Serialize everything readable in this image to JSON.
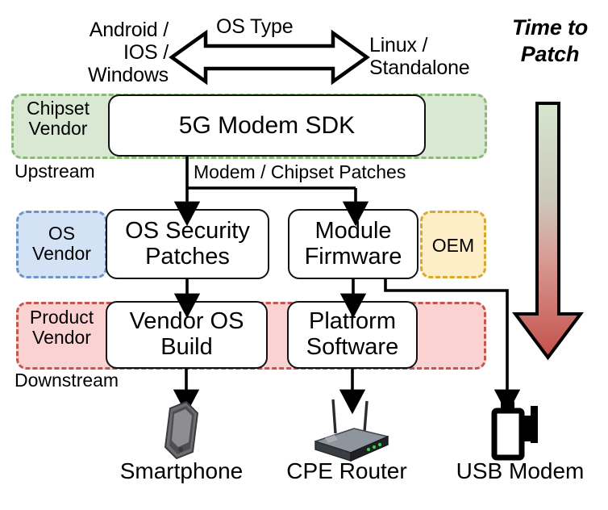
{
  "diagram": {
    "title_arrow": "Time to\nPatch",
    "os_type": {
      "label": "OS Type",
      "left_text": "Android /\nIOS /\nWindows",
      "right_text": "Linux /\nStandalone",
      "icon": "double-headed-arrow-icon"
    },
    "regions": [
      {
        "id": "chipset-vendor",
        "tag": "Chipset\nVendor",
        "fill": "#d9e8d2",
        "stroke": "#8cb87a"
      },
      {
        "id": "os-vendor",
        "tag": "OS\nVendor",
        "fill": "#d3e2f5",
        "stroke": "#6f93c4"
      },
      {
        "id": "oem",
        "tag": "OEM",
        "fill": "#fdeec7",
        "stroke": "#d8a92c"
      },
      {
        "id": "product-vendor",
        "tag": "Product\nVendor",
        "fill": "#fad2d2",
        "stroke": "#c3564f"
      }
    ],
    "stream_labels": {
      "upstream": "Upstream",
      "downstream": "Downstream"
    },
    "nodes": [
      {
        "id": "sdk",
        "label": "5G Modem SDK"
      },
      {
        "id": "os-sec",
        "label": "OS Security\nPatches"
      },
      {
        "id": "module-fw",
        "label": "Module\nFirmware"
      },
      {
        "id": "vendor-os",
        "label": "Vendor OS\nBuild"
      },
      {
        "id": "platform-sw",
        "label": "Platform\nSoftware"
      }
    ],
    "edge_labels": {
      "modem_chipset_patches": "Modem / Chipset Patches"
    },
    "devices": [
      {
        "id": "smartphone",
        "icon": "smartphone-icon",
        "caption": "Smartphone"
      },
      {
        "id": "cpe-router",
        "icon": "router-icon",
        "caption": "CPE Router"
      },
      {
        "id": "usb-modem",
        "icon": "usb-modem-icon",
        "caption": "USB Modem"
      }
    ],
    "arrow_gradient": {
      "top_color": "#d6e6cf",
      "bottom_color": "#c4504a"
    }
  }
}
